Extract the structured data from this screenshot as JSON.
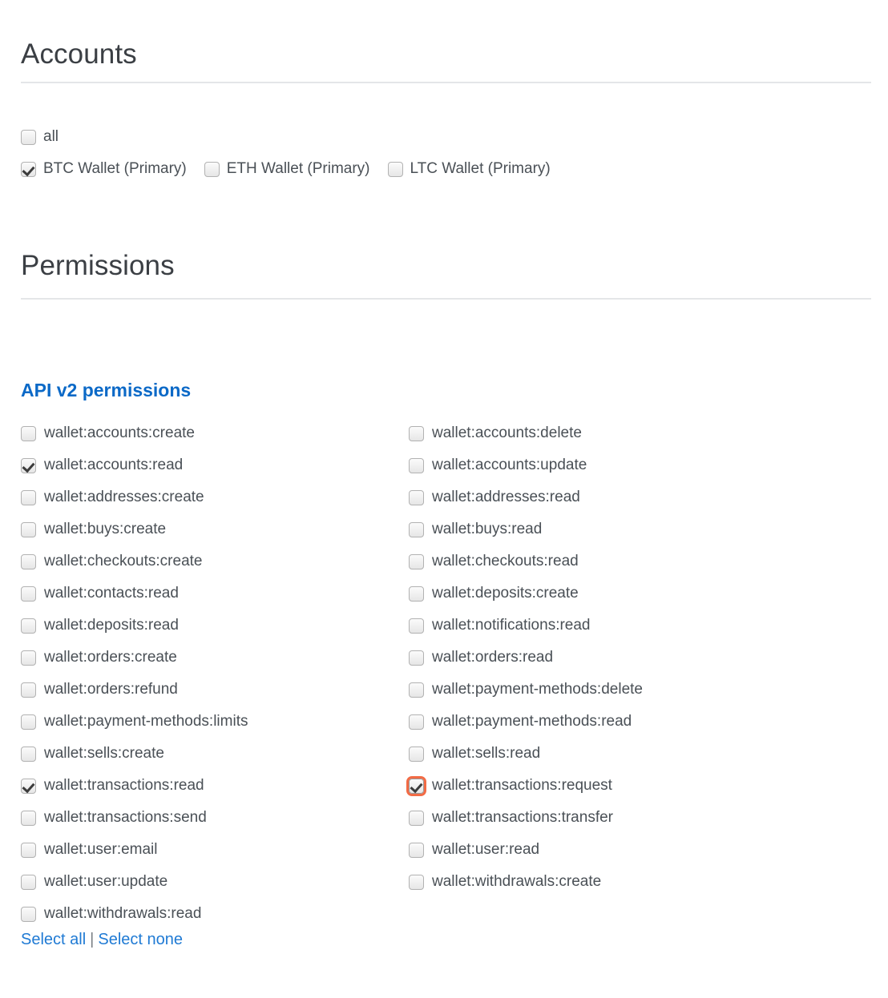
{
  "accounts": {
    "title": "Accounts",
    "all_label": "all",
    "all_checked": false,
    "wallets": [
      {
        "label": "BTC Wallet (Primary)",
        "checked": true
      },
      {
        "label": "ETH Wallet (Primary)",
        "checked": false
      },
      {
        "label": "LTC Wallet (Primary)",
        "checked": false
      }
    ]
  },
  "permissions": {
    "title": "Permissions",
    "api_heading": "API v2 permissions",
    "left_column": [
      {
        "label": "wallet:accounts:create",
        "checked": false,
        "focused": false
      },
      {
        "label": "wallet:accounts:read",
        "checked": true,
        "focused": false
      },
      {
        "label": "wallet:addresses:create",
        "checked": false,
        "focused": false
      },
      {
        "label": "wallet:buys:create",
        "checked": false,
        "focused": false
      },
      {
        "label": "wallet:checkouts:create",
        "checked": false,
        "focused": false
      },
      {
        "label": "wallet:contacts:read",
        "checked": false,
        "focused": false
      },
      {
        "label": "wallet:deposits:read",
        "checked": false,
        "focused": false
      },
      {
        "label": "wallet:orders:create",
        "checked": false,
        "focused": false
      },
      {
        "label": "wallet:orders:refund",
        "checked": false,
        "focused": false
      },
      {
        "label": "wallet:payment-methods:limits",
        "checked": false,
        "focused": false
      },
      {
        "label": "wallet:sells:create",
        "checked": false,
        "focused": false
      },
      {
        "label": "wallet:transactions:read",
        "checked": true,
        "focused": false
      },
      {
        "label": "wallet:transactions:send",
        "checked": false,
        "focused": false
      },
      {
        "label": "wallet:user:email",
        "checked": false,
        "focused": false
      },
      {
        "label": "wallet:user:update",
        "checked": false,
        "focused": false
      },
      {
        "label": "wallet:withdrawals:read",
        "checked": false,
        "focused": false
      }
    ],
    "right_column": [
      {
        "label": "wallet:accounts:delete",
        "checked": false,
        "focused": false
      },
      {
        "label": "wallet:accounts:update",
        "checked": false,
        "focused": false
      },
      {
        "label": "wallet:addresses:read",
        "checked": false,
        "focused": false
      },
      {
        "label": "wallet:buys:read",
        "checked": false,
        "focused": false
      },
      {
        "label": "wallet:checkouts:read",
        "checked": false,
        "focused": false
      },
      {
        "label": "wallet:deposits:create",
        "checked": false,
        "focused": false
      },
      {
        "label": "wallet:notifications:read",
        "checked": false,
        "focused": false
      },
      {
        "label": "wallet:orders:read",
        "checked": false,
        "focused": false
      },
      {
        "label": "wallet:payment-methods:delete",
        "checked": false,
        "focused": false
      },
      {
        "label": "wallet:payment-methods:read",
        "checked": false,
        "focused": false
      },
      {
        "label": "wallet:sells:read",
        "checked": false,
        "focused": false
      },
      {
        "label": "wallet:transactions:request",
        "checked": true,
        "focused": true
      },
      {
        "label": "wallet:transactions:transfer",
        "checked": false,
        "focused": false
      },
      {
        "label": "wallet:user:read",
        "checked": false,
        "focused": false
      },
      {
        "label": "wallet:withdrawals:create",
        "checked": false,
        "focused": false
      }
    ],
    "select_all_label": "Select all",
    "separator": "|",
    "select_none_label": "Select none"
  },
  "colors": {
    "link_blue": "#1f7ad4",
    "heading_blue": "#0b69c7",
    "text": "#4a5056",
    "title": "#3b3f44",
    "divider": "#e4e6e8",
    "focus_ring": "#f26b45"
  }
}
